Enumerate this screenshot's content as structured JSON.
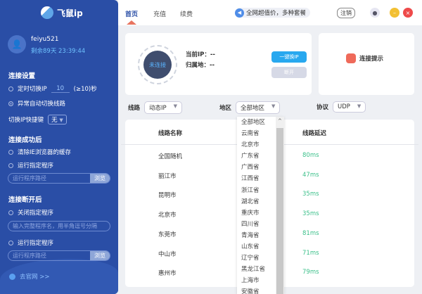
{
  "sidebar": {
    "app_name": "飞鼠ip",
    "username": "feiyu521",
    "remaining": "剩余89天 23:39:44",
    "conn_settings": "连接设置",
    "timed_switch": "定时切换IP",
    "interval": "10",
    "interval_hint": "(≥10)秒",
    "auto_switch": "异常自动切换线路",
    "hotkey_label": "切换IP快捷键",
    "hotkey_value": "无",
    "hotkey_arrow": "▼",
    "after_connect": "连接成功后",
    "clear_ie": "清除IE浏览器的缓存",
    "run_program": "运行指定程序",
    "program_path_placeholder": "运行程序路径",
    "browse": "浏览",
    "after_disconnect": "连接断开后",
    "close_program": "关闭指定程序",
    "close_program_placeholder": "输入完整程序名，用半角逗号分隔",
    "run_program2": "运行指定程序",
    "program_path_placeholder2": "运行程序路径",
    "browse2": "浏览",
    "website": "去官网 >>"
  },
  "header": {
    "tabs": [
      "首页",
      "充值",
      "续费"
    ],
    "notice": "全网超值价，多种套餐",
    "logout": "注销"
  },
  "status": {
    "state": "未连接",
    "current_ip_label": "当前IP：",
    "current_ip": "--",
    "location_label": "归属地：",
    "location": "--",
    "switch_btn": "一键换IP",
    "disconnect_btn": "断开",
    "hint": "连接提示"
  },
  "filters": {
    "line_label": "线路",
    "line_value": "动态IP",
    "region_label": "地区",
    "region_value": "全部地区",
    "protocol_label": "协议",
    "protocol_value": "UDP"
  },
  "table": {
    "headers": [
      "线路名称",
      "线路延迟"
    ],
    "rows": [
      [
        "全国随机",
        "80ms"
      ],
      [
        "丽江市",
        "47ms"
      ],
      [
        "昆明市",
        "35ms"
      ],
      [
        "北京市",
        "35ms"
      ],
      [
        "东莞市",
        "81ms"
      ],
      [
        "中山市",
        "71ms"
      ],
      [
        "惠州市",
        "79ms"
      ]
    ]
  },
  "region_options": [
    "全部地区",
    "云南省",
    "北京市",
    "广东省",
    "广西省",
    "江西省",
    "浙江省",
    "湖北省",
    "重庆市",
    "四川省",
    "青海省",
    "山东省",
    "辽宁省",
    "黑龙江省",
    "上海市",
    "安徽省"
  ]
}
